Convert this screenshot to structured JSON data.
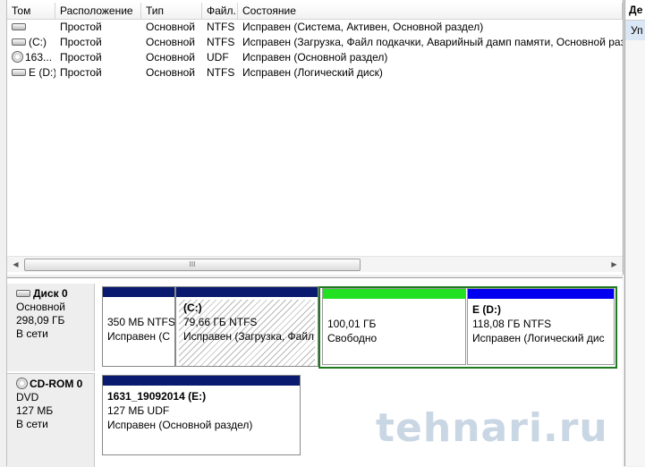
{
  "columns": [
    "Том",
    "Расположение",
    "Тип",
    "Файл...",
    "Состояние"
  ],
  "volumes": [
    {
      "icon": "disk-icon",
      "name": "",
      "layout": "Простой",
      "type": "Основной",
      "fs": "NTFS",
      "status": "Исправен (Система, Активен, Основной раздел)"
    },
    {
      "icon": "disk-icon",
      "name": "(C:)",
      "layout": "Простой",
      "type": "Основной",
      "fs": "NTFS",
      "status": "Исправен (Загрузка, Файл подкачки, Аварийный дамп памяти, Основной раздел)"
    },
    {
      "icon": "cd-icon",
      "name": "163...",
      "layout": "Простой",
      "type": "Основной",
      "fs": "UDF",
      "status": "Исправен (Основной раздел)"
    },
    {
      "icon": "disk-icon",
      "name": "E (D:)",
      "layout": "Простой",
      "type": "Основной",
      "fs": "NTFS",
      "status": "Исправен (Логический диск)"
    }
  ],
  "scrollbar": {
    "thumb_grip": "III",
    "left_arrow": "◀",
    "right_arrow": "▶"
  },
  "action_panel": {
    "header": "Де",
    "item": "Уп"
  },
  "disks": [
    {
      "label": "Диск 0",
      "kind": "Основной",
      "size": "298,09 ГБ",
      "state": "В сети",
      "partitions": [
        {
          "name": "",
          "size": "350 МБ NTFS",
          "status": "Исправен (С"
        },
        {
          "name": "(C:)",
          "size": "79,66 ГБ NTFS",
          "status": "Исправен (Загрузка, Файл"
        },
        {
          "name": "",
          "size": "100,01 ГБ",
          "status": "Свободно"
        },
        {
          "name": "E  (D:)",
          "size": "118,08 ГБ NTFS",
          "status": "Исправен (Логический дис"
        }
      ]
    },
    {
      "label": "CD-ROM 0",
      "kind": "DVD",
      "size": "127 МБ",
      "state": "В сети",
      "partitions": [
        {
          "name": "1631_19092014  (E:)",
          "size": "127 МБ UDF",
          "status": "Исправен (Основной раздел)"
        }
      ]
    }
  ],
  "colors": {
    "primary_bar": "#0a1a6e",
    "free_bar": "#22e022",
    "logical_bar": "#0000f0",
    "selection_border": "#1f7a1f"
  },
  "watermark": "tehnari.ru"
}
